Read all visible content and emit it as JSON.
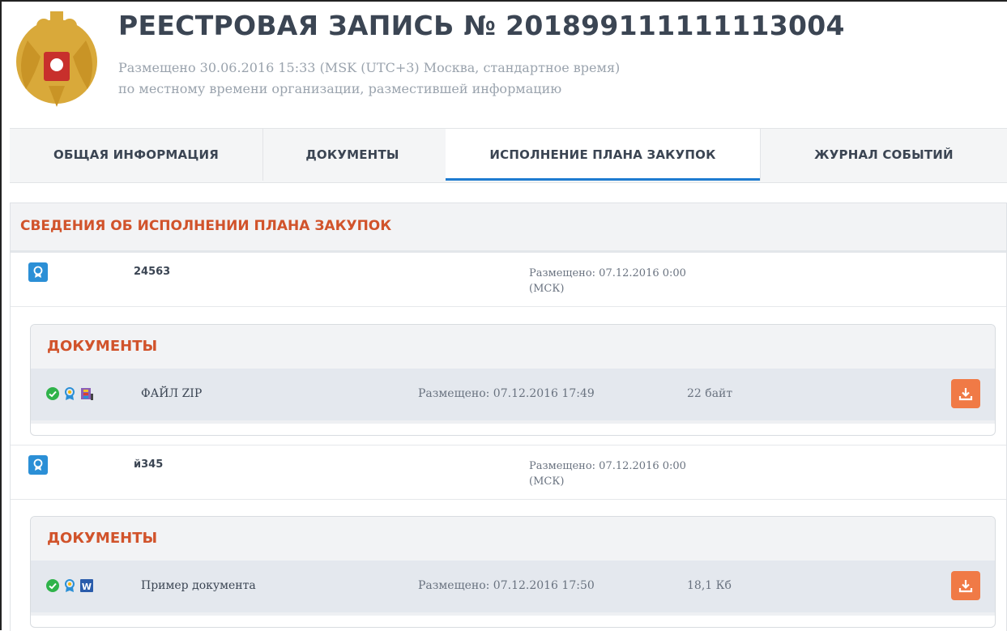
{
  "header": {
    "title": "РЕЕСТРОВАЯ ЗАПИСЬ № 201899111111113004",
    "posted_line1": "Размещено 30.06.2016 15:33 (MSK (UTC+3) Москва, стандартное время)",
    "posted_line2": "по местному времени организации, разместившей информацию"
  },
  "tabs": [
    {
      "label": "ОБЩАЯ ИНФОРМАЦИЯ",
      "active": false
    },
    {
      "label": "ДОКУМЕНТЫ",
      "active": false
    },
    {
      "label": "ИСПОЛНЕНИЕ ПЛАНА ЗАКУПОК",
      "active": true
    },
    {
      "label": "ЖУРНАЛ СОБЫТИЙ",
      "active": false
    }
  ],
  "section": {
    "title": "СВЕДЕНИЯ ОБ ИСПОЛНЕНИИ ПЛАНА ЗАКУПОК",
    "records": [
      {
        "number": "24563",
        "placed": "Размещено: 07.12.2016 0:00",
        "placed_tz": "(МСК)",
        "documents_title": "ДОКУМЕНТЫ",
        "documents": [
          {
            "name": "ФАЙЛ ZIP",
            "placed": "Размещено: 07.12.2016 17:49",
            "size": "22 байт",
            "file_icon": "archive-icon"
          }
        ]
      },
      {
        "number": "й345",
        "placed": "Размещено: 07.12.2016 0:00",
        "placed_tz": "(МСК)",
        "documents_title": "ДОКУМЕНТЫ",
        "documents": [
          {
            "name": "Пример документа",
            "placed": "Размещено: 07.12.2016 17:50",
            "size": "18,1 Кб",
            "file_icon": "word-doc-icon"
          }
        ]
      }
    ]
  },
  "colors": {
    "accent_red": "#d1532b",
    "tab_active_underline": "#1e7bd0",
    "download_button": "#f07a46",
    "record_icon": "#2b8fd6",
    "status_ok": "#2fb34a"
  }
}
